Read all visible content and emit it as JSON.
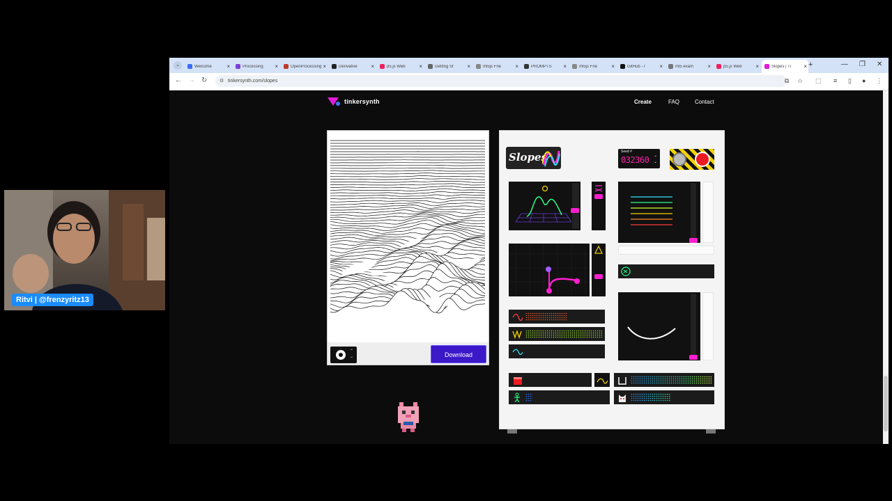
{
  "browser": {
    "tabs": [
      {
        "label": "Welcome",
        "color": "#3b6cf6"
      },
      {
        "label": "Processing",
        "color": "#7b3fd6"
      },
      {
        "label": "OpenProcessing",
        "color": "#c0392b"
      },
      {
        "label": "Derivative",
        "color": "#222222"
      },
      {
        "label": "p5.js Web",
        "color": "#ed225d"
      },
      {
        "label": "Getting St",
        "color": "#666666"
      },
      {
        "label": "ml5js Frie",
        "color": "#888888"
      },
      {
        "label": "PROMPTS",
        "color": "#333333"
      },
      {
        "label": "ml5js Frie",
        "color": "#888888"
      },
      {
        "label": "GitHub - r",
        "color": "#111111"
      },
      {
        "label": "ml5 exam",
        "color": "#777777"
      },
      {
        "label": "p5.js Web",
        "color": "#ed225d"
      },
      {
        "label": "Slopes | Ti",
        "color": "#e11bd6"
      }
    ],
    "url": "tinkersynth.com/slopes"
  },
  "site": {
    "brand": "tinkersynth",
    "nav": {
      "create": "Create",
      "faq": "FAQ",
      "contact": "Contact"
    }
  },
  "canvas_card": {
    "download_label": "Download"
  },
  "synth": {
    "title": "Slopes",
    "seed_label": "Seed #",
    "seed_value": "032360"
  },
  "webcam": {
    "name_tag": "Ritvi | @frenzyritz13"
  },
  "colors": {
    "accent": "#e11bd6",
    "download": "#3b18c8",
    "slider_thumb": "#ff1fd0",
    "seed_digits": "#ff1fa8"
  }
}
